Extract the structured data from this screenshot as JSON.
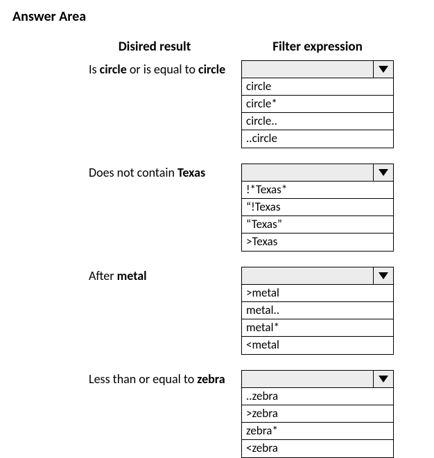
{
  "title": "Answer Area",
  "header_desired": "Disired result",
  "header_filter": "Filter expression",
  "rows": [
    {
      "desired_pre": "Is ",
      "desired_bold1": "circle",
      "desired_mid": " or is equal to ",
      "desired_bold2": "circle",
      "options": [
        "circle",
        "circle*",
        "circle..",
        "..circle"
      ]
    },
    {
      "desired_pre": "Does not contain ",
      "desired_bold1": "Texas",
      "desired_mid": "",
      "desired_bold2": "",
      "options": [
        "!*Texas*",
        "“!Texas",
        "“Texas”",
        ">Texas"
      ]
    },
    {
      "desired_pre": "After ",
      "desired_bold1": "metal",
      "desired_mid": "",
      "desired_bold2": "",
      "options": [
        ">metal",
        "metal..",
        "metal*",
        "<metal"
      ]
    },
    {
      "desired_pre": "Less than or equal to ",
      "desired_bold1": "zebra",
      "desired_mid": "",
      "desired_bold2": "",
      "options": [
        "..zebra",
        ">zebra",
        "zebra*",
        "<zebra"
      ]
    }
  ]
}
